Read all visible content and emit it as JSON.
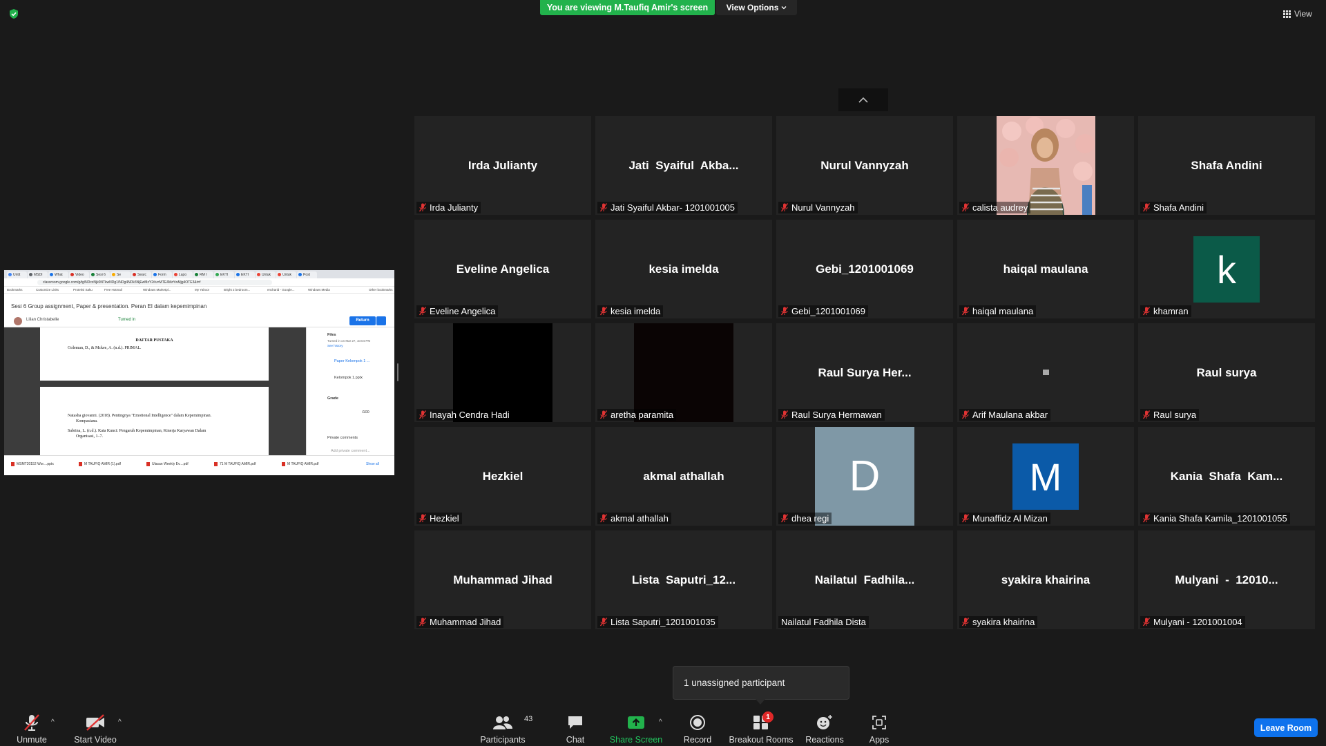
{
  "banner": {
    "text": "You are viewing M.Taufiq Amir's screen",
    "view_options": "View Options"
  },
  "view_button": "View",
  "shared_screen": {
    "tabs": [
      "Untit",
      "MSDI",
      "What",
      "Video",
      "Sesi 6",
      "Se",
      "Searc",
      "Form",
      "Lapo",
      "RM I",
      "EKTI",
      "EKTI",
      "Untuk",
      "Untuk",
      "Post"
    ],
    "url": "classroom.google.com/g/tg/NDczNjk0NTkwNDg1/NDg4NDk3NjEwMzY2#u=MTE4MzYwMjg4OTE3&t=f",
    "bookmarks": [
      "Bookmarks",
      "Customize Links",
      "Proteksi Saku",
      "Free Hotmail",
      "Windows Marketpl...",
      "My Yahoo!",
      "Bright 2 bedroom...",
      "encharid - Google...",
      "Windows Media",
      "Other bookmarks"
    ],
    "page_title": "Sesi 6 Group assignment, Paper & presentation. Peran EI dalam kepemimpinan",
    "student": "Lilian Christabelle",
    "status": "Turned in",
    "return_label": "Return",
    "doc_title": "DAFTAR PUSTAKA",
    "doc_line1": "Goleman, D., & Mckee, A. (n.d.). PRIMAL.",
    "doc_line2": "Natasha giovanni. (2018). Pentingnya \"Emotional Intelligence\" dalam Kepemimpinan.",
    "doc_line3": "Kompasiana.",
    "doc_line4": "Sabrina, L. (n.d.). Kata Kunci: Pengaruh Kepemimpinan, Kinerja Karyawan Dalam",
    "doc_line5": "Organisasi, 1–7.",
    "side_files": "Files",
    "side_turned": "Turned in on Mar 27, 10:04 PM",
    "side_history": "See history",
    "side_file1": "Paper Kelompok 1 ...",
    "side_file2": "Kelompok 1.pptx",
    "side_grade": "Grade",
    "side_grade_val": "/100",
    "side_comments": "Private comments",
    "side_add_comment": "Add private comment...",
    "downloads": [
      "MSMT20152 Wor....pptx",
      "M TAUFIQ AMIR (1).pdf",
      "Ulasan Weekly Ev....pdf",
      "71 M TAUFIQ AMIR.pdf",
      "M TAUFIQ AMIR.pdf"
    ],
    "show_all": "Show all"
  },
  "participants": [
    {
      "display": "Irda Julianty",
      "label": "Irda Julianty",
      "muted": true
    },
    {
      "display": "Jati  Syaiful  Akba...",
      "label": "Jati Syaiful Akbar- 1201001005",
      "muted": true
    },
    {
      "display": "Nurul Vannyzah",
      "label": "Nurul Vannyzah",
      "muted": true
    },
    {
      "display": "",
      "label": "calista audrey",
      "muted": true,
      "media": "photo"
    },
    {
      "display": "Shafa Andini",
      "label": "Shafa Andini",
      "muted": true
    },
    {
      "display": "Eveline Angelica",
      "label": "Eveline Angelica",
      "muted": true
    },
    {
      "display": "kesia imelda",
      "label": "kesia imelda",
      "muted": true
    },
    {
      "display": "Gebi_1201001069",
      "label": "Gebi_1201001069",
      "muted": true
    },
    {
      "display": "haiqal maulana",
      "label": "haiqal maulana",
      "muted": true
    },
    {
      "display": "",
      "label": "khamran",
      "muted": true,
      "media": "avatar",
      "letter": "k",
      "color": "#0b5a48"
    },
    {
      "display": "",
      "label": "Inayah Cendra Hadi",
      "muted": true,
      "media": "video-black"
    },
    {
      "display": "",
      "label": "aretha paramita",
      "muted": true,
      "media": "video-dark"
    },
    {
      "display": "Raul Surya Her...",
      "label": "Raul Surya Hermawan",
      "muted": true
    },
    {
      "display": "",
      "label": "Arif Maulana akbar",
      "muted": true,
      "media": "tiny"
    },
    {
      "display": "Raul surya",
      "label": "Raul surya",
      "muted": true
    },
    {
      "display": "Hezkiel",
      "label": "Hezkiel",
      "muted": true
    },
    {
      "display": "akmal athallah",
      "label": "akmal athallah",
      "muted": true
    },
    {
      "display": "",
      "label": "dhea regi",
      "muted": true,
      "media": "avatar-big",
      "letter": "D",
      "color": "#7f98a6"
    },
    {
      "display": "",
      "label": "Munaffidz Al Mizan",
      "muted": true,
      "media": "avatar",
      "letter": "M",
      "color": "#0b5aa8"
    },
    {
      "display": "Kania  Shafa  Kam...",
      "label": "Kania Shafa Kamila_1201001055",
      "muted": true
    },
    {
      "display": "Muhammad Jihad",
      "label": "Muhammad Jihad",
      "muted": true
    },
    {
      "display": "Lista  Saputri_12...",
      "label": "Lista Saputri_1201001035",
      "muted": true
    },
    {
      "display": "Nailatul  Fadhila...",
      "label": "Nailatul Fadhila Dista",
      "muted": false
    },
    {
      "display": "syakira khairina",
      "label": "syakira khairina",
      "muted": true
    },
    {
      "display": "Mulyani  -  12010...",
      "label": "Mulyani - 1201001004",
      "muted": true
    }
  ],
  "toast": "1 unassigned participant",
  "toolbar": {
    "unmute": "Unmute",
    "start_video": "Start Video",
    "participants": "Participants",
    "participants_count": "43",
    "chat": "Chat",
    "share_screen": "Share Screen",
    "record": "Record",
    "breakout": "Breakout Rooms",
    "breakout_badge": "1",
    "reactions": "Reactions",
    "apps": "Apps",
    "leave": "Leave Room"
  },
  "colors": {
    "share_green": "#22b24c",
    "leave_blue": "#0e72ed",
    "mute_red": "#e03333",
    "badge_red": "#e02828"
  }
}
